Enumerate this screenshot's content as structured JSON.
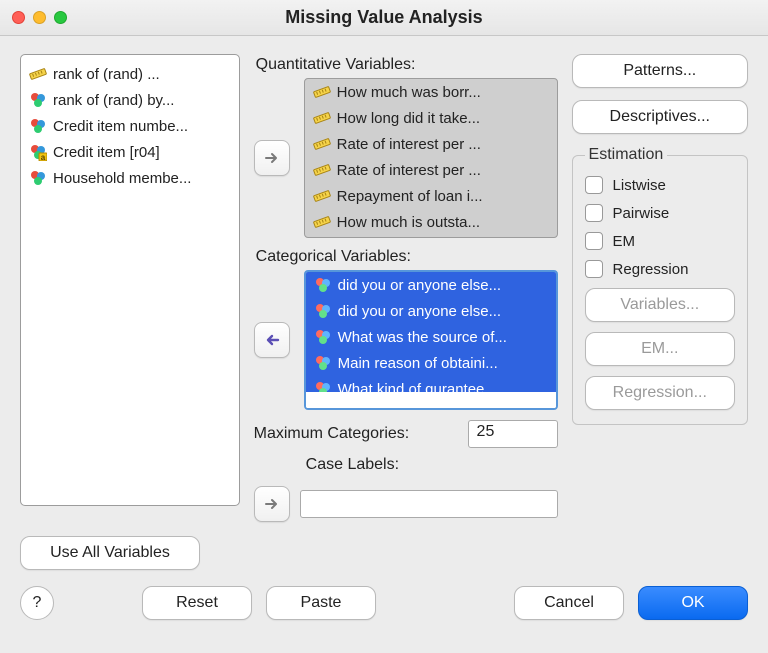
{
  "title": "Missing Value Analysis",
  "source_vars": [
    {
      "icon": "scale",
      "label": "rank of (rand)     ..."
    },
    {
      "icon": "spheres",
      "label": "rank of (rand)   by..."
    },
    {
      "icon": "spheres",
      "label": "Credit item numbe..."
    },
    {
      "icon": "spheres-a",
      "label": "Credit item [r04]"
    },
    {
      "icon": "spheres",
      "label": "Household membe..."
    }
  ],
  "quant_label": "Quantitative Variables:",
  "quant_vars": [
    "How much was borr...",
    "How long did it take...",
    "Rate of interest per ...",
    "Rate of interest per ...",
    "Repayment of loan i...",
    "How much  is outsta..."
  ],
  "cat_label": "Categorical Variables:",
  "cat_vars": [
    "did you or anyone else...",
    "did you or anyone else...",
    "What was the source of...",
    "Main reason of obtaini...",
    "What kind of qurantee..."
  ],
  "maxcat_label": "Maximum Categories:",
  "maxcat_value": "25",
  "caselabels_label": "Case Labels:",
  "right": {
    "patterns": "Patterns...",
    "descriptives": "Descriptives...",
    "estimation_legend": "Estimation",
    "listwise": "Listwise",
    "pairwise": "Pairwise",
    "em": "EM",
    "regression": "Regression",
    "variables_btn": "Variables...",
    "em_btn": "EM...",
    "regression_btn": "Regression..."
  },
  "useall": "Use All Variables",
  "footer": {
    "help": "?",
    "reset": "Reset",
    "paste": "Paste",
    "cancel": "Cancel",
    "ok": "OK"
  }
}
